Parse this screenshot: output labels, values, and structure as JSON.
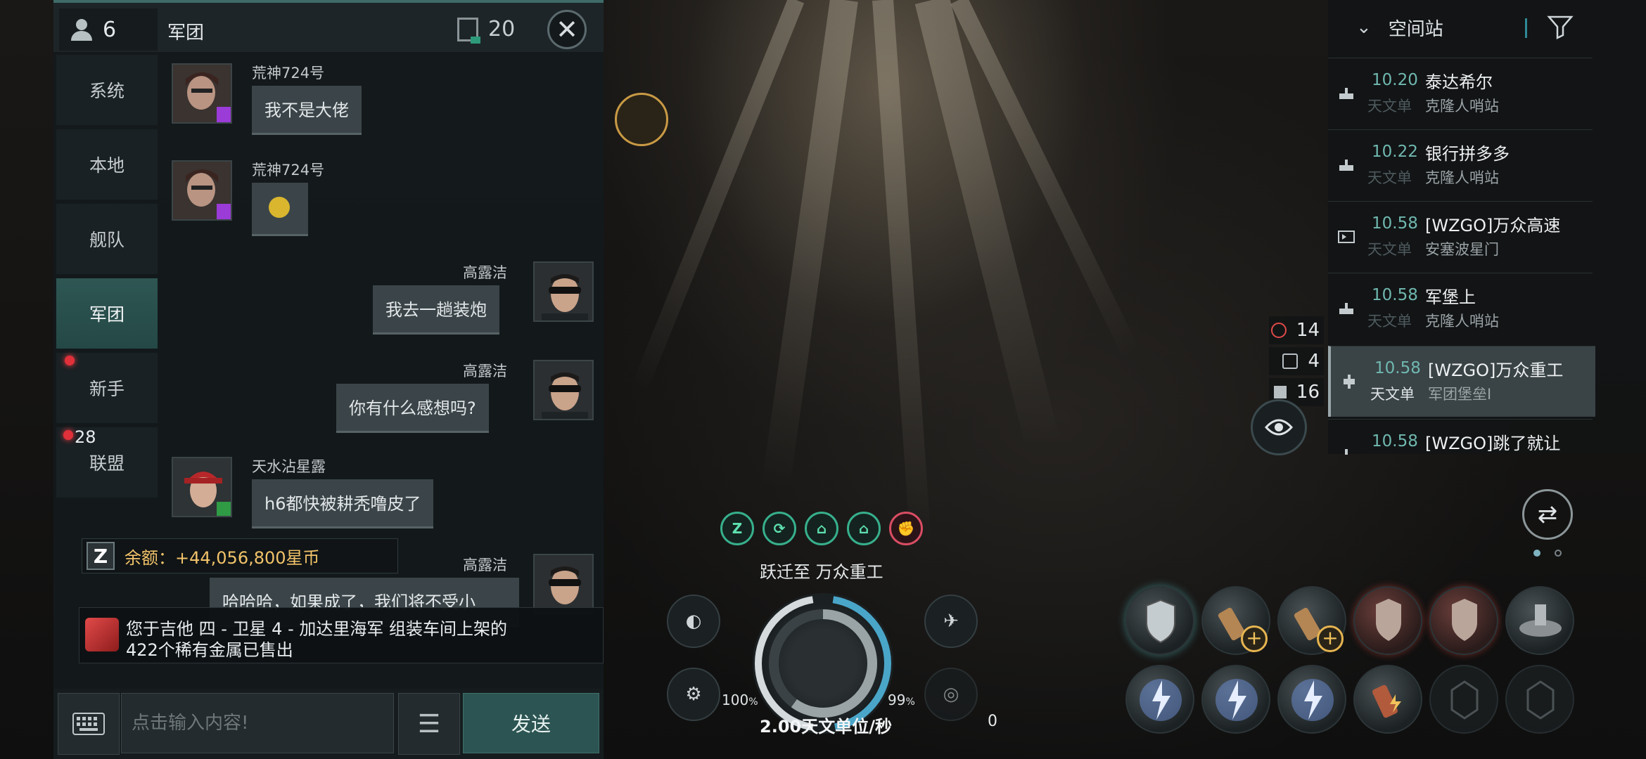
{
  "chat": {
    "member_count": "6",
    "channel_title": "军团",
    "message_count": "20",
    "tabs": [
      {
        "label": "系统"
      },
      {
        "label": "本地"
      },
      {
        "label": "舰队"
      },
      {
        "label": "军团"
      },
      {
        "label": "新手"
      },
      {
        "label": "联盟"
      }
    ],
    "tab_badge": "28",
    "messages": [
      {
        "sender": "荒神724号",
        "text": "我不是大佬",
        "side": "left"
      },
      {
        "sender": "荒神724号",
        "text": "",
        "side": "left",
        "emoji": "face-emoji"
      },
      {
        "sender": "高露洁",
        "text": "我去一趟装炮",
        "side": "right"
      },
      {
        "sender": "高露洁",
        "text": "你有什么感想吗?",
        "side": "right"
      },
      {
        "sender": "天水沾星露",
        "text": "h6都快被耕秃噜皮了",
        "side": "left"
      },
      {
        "sender": "高露洁",
        "text": "哈哈哈，如果成了，我们将不受小",
        "side": "right"
      }
    ],
    "balance_text": "余额：+44,056,800星币",
    "notice_line1": "您于吉他 四 - 卫星 4 - 加达里海军 组装车间上架的",
    "notice_line2": "422个稀有金属已售出",
    "input_placeholder": "点击输入内容!",
    "send_label": "发送"
  },
  "overview": {
    "header_label": "空间站",
    "rows": [
      {
        "distance": "10.20",
        "unit": "天文单",
        "name": "泰达希尔",
        "type": "克隆人哨站",
        "icon": "station-icon"
      },
      {
        "distance": "10.22",
        "unit": "天文单",
        "name": "银行拼多多",
        "type": "克隆人哨站",
        "icon": "station-icon"
      },
      {
        "distance": "10.58",
        "unit": "天文单",
        "name": "[WZGO]万众高速",
        "type": "安塞波星门",
        "icon": "gate-icon"
      },
      {
        "distance": "10.58",
        "unit": "天文单",
        "name": "军堡上",
        "type": "克隆人哨站",
        "icon": "station-icon"
      },
      {
        "distance": "10.58",
        "unit": "天文单",
        "name": "[WZGO]万众重工",
        "type": "军团堡垒I",
        "icon": "fortress-icon",
        "selected": true
      },
      {
        "distance": "10.58",
        "unit": "",
        "name": "[WZGO]跳了就让",
        "type": "",
        "icon": "station-icon"
      }
    ]
  },
  "counts": [
    {
      "value": "14",
      "icon": "target-icon"
    },
    {
      "value": "4",
      "icon": "drone-icon"
    },
    {
      "value": "16",
      "icon": "cargo-icon"
    }
  ],
  "hud": {
    "warp_text": "跃迁至 万众重工",
    "speed_text": "2.00天文单位/秒",
    "shield_pct": "100",
    "armor_pct": "99",
    "pct_sign": "%",
    "speed_zero": "0",
    "effect_icons": [
      "Z",
      "⟳",
      "⌂",
      "⌂",
      "✊"
    ],
    "shield_level": 1.0,
    "armor_level": 0.99,
    "capacitor_level": 0.6
  },
  "colors": {
    "accent": "#2c5452",
    "teal_text": "#70b8b0",
    "gold": "#f2c36a",
    "alert_red": "#e0303a"
  }
}
